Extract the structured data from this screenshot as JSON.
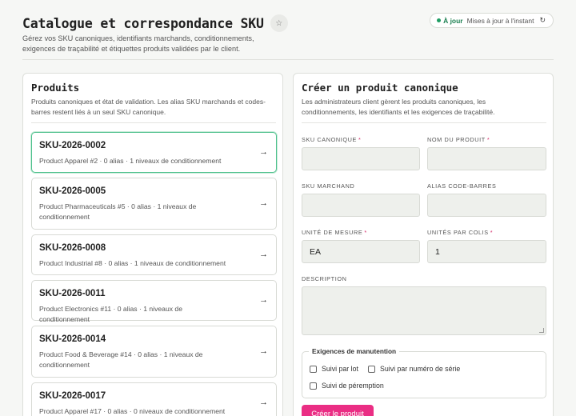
{
  "header": {
    "title": "Catalogue et correspondance SKU",
    "subtitle": "Gérez vos SKU canoniques, identifiants marchands, conditionnements, exigences de traçabilité et étiquettes produits validées par le client.",
    "star_icon": "☆",
    "status_label": "À jour",
    "status_text": "Mises à jour à l'instant",
    "refresh_icon": "↻",
    "status_color": "#1f9d63"
  },
  "products_panel": {
    "title": "Produits",
    "description": "Produits canoniques et état de validation. Les alias SKU marchands et codes-barres restent liés à un seul SKU canonique.",
    "items": [
      {
        "sku": "SKU-2026-0002",
        "meta": "Product Apparel #2 · 0 alias · 1 niveaux de conditionnement",
        "selected": true
      },
      {
        "sku": "SKU-2026-0005",
        "meta": "Product Pharmaceuticals #5 · 0 alias · 1 niveaux de conditionnement",
        "selected": false
      },
      {
        "sku": "SKU-2026-0008",
        "meta": "Product Industrial #8 · 0 alias · 1 niveaux de conditionnement",
        "selected": false
      },
      {
        "sku": "SKU-2026-0011",
        "meta": "Product Electronics #11 · 0 alias · 1 niveaux de conditionnement",
        "selected": false
      },
      {
        "sku": "SKU-2026-0014",
        "meta": "Product Food & Beverage #14 · 0 alias · 1 niveaux de conditionnement",
        "selected": false
      },
      {
        "sku": "SKU-2026-0017",
        "meta": "Product Apparel #17 · 0 alias · 0 niveaux de conditionnement",
        "selected": false
      }
    ],
    "arrow_icon": "→",
    "selected_color": "#4fc08d"
  },
  "create_panel": {
    "title": "Créer un produit canonique",
    "description": "Les administrateurs client gèrent les produits canoniques, les conditionnements, les identifiants et les exigences de traçabilité.",
    "required_mark": "*",
    "fields": {
      "sku_canonical": {
        "label": "SKU CANONIQUE",
        "value": ""
      },
      "product_name": {
        "label": "NOM DU PRODUIT",
        "value": ""
      },
      "merchant_sku": {
        "label": "SKU MARCHAND",
        "value": ""
      },
      "barcode_alias": {
        "label": "ALIAS CODE-BARRES",
        "value": ""
      },
      "unit": {
        "label": "UNITÉ DE MESURE",
        "value": "EA"
      },
      "units_per_case": {
        "label": "UNITÉS PAR COLIS",
        "value": "1"
      },
      "description": {
        "label": "DESCRIPTION",
        "value": ""
      }
    },
    "handling": {
      "legend": "Exigences de manutention",
      "lot": "Suivi par lot",
      "serial": "Suivi par numéro de série",
      "expiry": "Suivi de péremption"
    },
    "submit_label": "Créer le produit",
    "accent_color": "#ea2e84"
  }
}
